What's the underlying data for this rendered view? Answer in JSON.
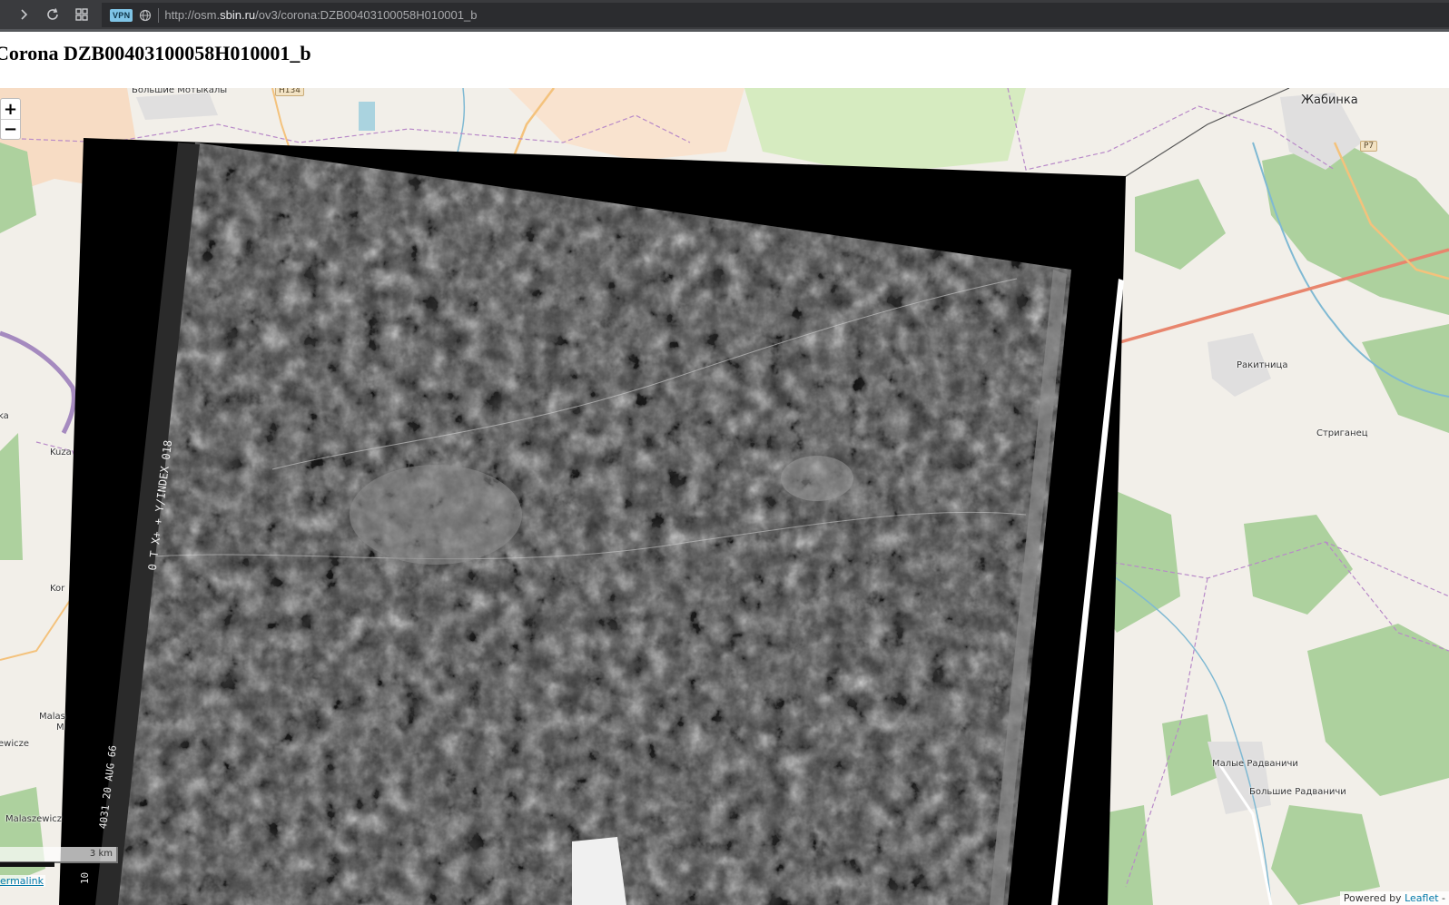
{
  "browser": {
    "vpn_label": "VPN",
    "url_prefix": "http://osm.",
    "url_host": "sbin.ru",
    "url_path": "/ov3/corona:DZB00403100058H010001_b"
  },
  "page": {
    "title": "Corona DZB00403100058H010001_b"
  },
  "map": {
    "zoom_in": "+",
    "zoom_out": "−",
    "scale_label": "3 km",
    "permalink": "ermalink",
    "attribution_prefix": "Powered by ",
    "attribution_link": "Leaflet",
    "attribution_suffix": " -",
    "places": {
      "bolshie_motykaly": "Большие Мотыкалы",
      "zhabinka": "Жабинка",
      "rakitnitsa": "Ракитница",
      "striganets": "Стриганец",
      "malye_radvanichi": "Малые Радваничи",
      "bolshie_radvanichi": "Большие Радваничи",
      "kuza": "Kuza",
      "kor": "Kor",
      "ka": "ka",
      "malas": "Malas",
      "m": "M",
      "ewicze": "ewicze",
      "malaszewicz": "Malaszewicz"
    },
    "road_badges": {
      "h134": "H134",
      "p7": "P7"
    },
    "overlay_text": {
      "index": "0 T X+ + Y/INDEX  018",
      "date": "4031 20 AUG 66",
      "edge": "10"
    }
  }
}
